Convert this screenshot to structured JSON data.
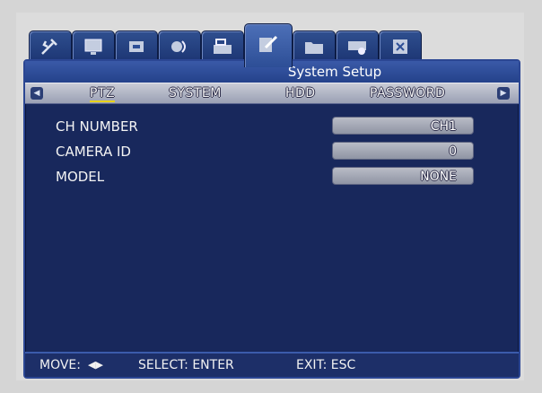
{
  "window": {
    "title": "System Setup"
  },
  "top_tabs": [
    {
      "icon": "tools-icon"
    },
    {
      "icon": "monitor-icon"
    },
    {
      "icon": "record-icon"
    },
    {
      "icon": "network-icon"
    },
    {
      "icon": "device-icon"
    },
    {
      "icon": "system-setup-icon"
    },
    {
      "icon": "folder-icon"
    },
    {
      "icon": "backup-icon"
    },
    {
      "icon": "close-icon"
    }
  ],
  "subtabs": [
    {
      "label": "PTZ",
      "active": true
    },
    {
      "label": "SYSTEM"
    },
    {
      "label": "HDD"
    },
    {
      "label": "PASSWORD"
    }
  ],
  "settings": [
    {
      "label": "CH NUMBER",
      "value": "CH1"
    },
    {
      "label": "CAMERA ID",
      "value": "0"
    },
    {
      "label": "MODEL",
      "value": "NONE"
    }
  ],
  "status": {
    "move": "MOVE:",
    "select": "SELECT: ENTER",
    "exit": "EXIT: ESC"
  },
  "colors": {
    "window_bg": "#18285c",
    "title_bar": "#3a5aa8",
    "active_underline": "#e8d21a"
  }
}
